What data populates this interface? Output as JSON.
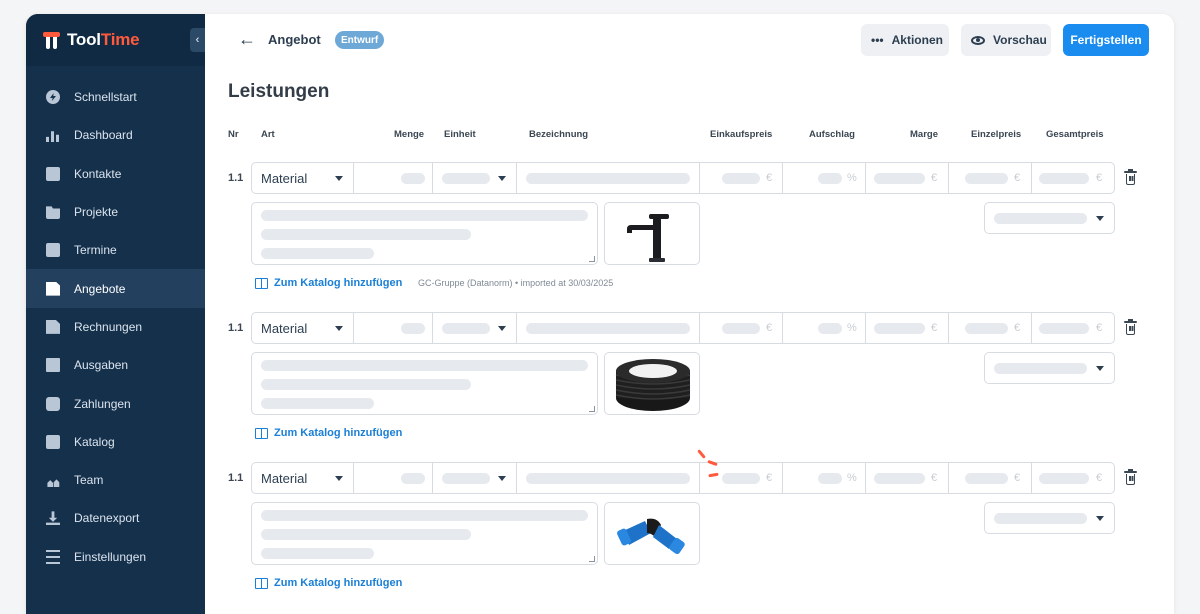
{
  "app": {
    "brand": {
      "name_part1": "Tool",
      "name_part2": "Time",
      "brand_color": "#ff5a3c"
    },
    "collapse_icon": "chevron-left-icon"
  },
  "sidebar": {
    "items": [
      {
        "label": "Schnellstart",
        "icon": "bolt-icon",
        "active": false
      },
      {
        "label": "Dashboard",
        "icon": "bar-chart-icon",
        "active": false
      },
      {
        "label": "Kontakte",
        "icon": "contact-card-icon",
        "active": false
      },
      {
        "label": "Projekte",
        "icon": "folder-icon",
        "active": false
      },
      {
        "label": "Termine",
        "icon": "calendar-icon",
        "active": false
      },
      {
        "label": "Angebote",
        "icon": "document-icon",
        "active": true
      },
      {
        "label": "Rechnungen",
        "icon": "invoice-icon",
        "active": false
      },
      {
        "label": "Ausgaben",
        "icon": "receipt-icon",
        "active": false
      },
      {
        "label": "Zahlungen",
        "icon": "wallet-icon",
        "active": false
      },
      {
        "label": "Katalog",
        "icon": "book-icon",
        "active": false
      },
      {
        "label": "Team",
        "icon": "team-icon",
        "active": false
      },
      {
        "label": "Datenexport",
        "icon": "download-icon",
        "active": false
      },
      {
        "label": "Einstellungen",
        "icon": "sliders-icon",
        "active": false
      }
    ]
  },
  "header": {
    "title": "Angebot",
    "status_badge": "Entwurf",
    "actions_label": "Aktionen",
    "preview_label": "Vorschau",
    "finish_label": "Fertigstellen",
    "primary_color": "#1a8cf0"
  },
  "main": {
    "section_title": "Leistungen",
    "columns": [
      "Nr",
      "Art",
      "Menge",
      "Einheit",
      "Bezeichnung",
      "Einkaufspreis",
      "Aufschlag",
      "Marge",
      "Einzelpreis",
      "Gesamtpreis"
    ],
    "rows": [
      {
        "nr": "1.1",
        "art": "Material",
        "image": "faucet",
        "catalog_link": "Zum Katalog hinzufügen",
        "import_note": "GC-Gruppe (Datanorm) • imported at 30/03/2025"
      },
      {
        "nr": "1.1",
        "art": "Material",
        "image": "pipe-coil",
        "catalog_link": "Zum Katalog hinzufügen",
        "import_note": ""
      },
      {
        "nr": "1.1",
        "art": "Material",
        "image": "pipe-elbow-fitting",
        "catalog_link": "Zum Katalog hinzufügen",
        "import_note": ""
      }
    ],
    "suffixes": {
      "currency": "€",
      "percent": "%"
    }
  }
}
